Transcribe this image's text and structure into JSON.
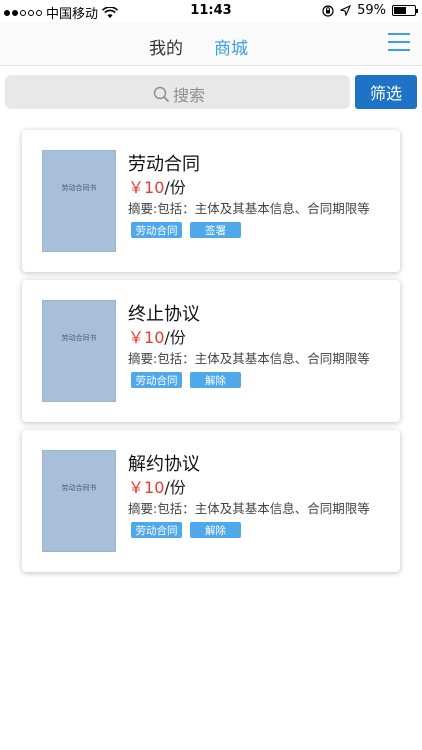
{
  "status_bar": {
    "carrier": "中国移动",
    "time": "11:43",
    "battery": "59%",
    "battery_level": 0.59,
    "signal_bars_filled": 2,
    "signal_bars_total": 5
  },
  "nav": {
    "tabs": [
      {
        "label": "我的",
        "active": false
      },
      {
        "label": "商城",
        "active": true
      }
    ],
    "accent_color": "#3a9ee8",
    "menu_icon": "hamburger-menu-icon"
  },
  "search": {
    "placeholder": "搜索",
    "icon": "search-icon",
    "filter_label": "筛选",
    "filter_color": "#1f73c6"
  },
  "products": [
    {
      "title": "劳动合同",
      "price_symbol": "￥",
      "price_amount": "10",
      "price_unit": "/份",
      "summary": "摘要:包括：主体及其基本信息、合同期限等",
      "tags": [
        "劳动合同",
        "签署"
      ],
      "thumb_title": "劳动合同书"
    },
    {
      "title": "终止协议",
      "price_symbol": "￥",
      "price_amount": "10",
      "price_unit": "/份",
      "summary": "摘要:包括：主体及其基本信息、合同期限等",
      "tags": [
        "劳动合同",
        "解除"
      ],
      "thumb_title": "劳动合同书"
    },
    {
      "title": "解约协议",
      "price_symbol": "￥",
      "price_amount": "10",
      "price_unit": "/份",
      "summary": "摘要:包括：主体及其基本信息、合同期限等",
      "tags": [
        "劳动合同",
        "解除"
      ],
      "thumb_title": "劳动合同书"
    }
  ],
  "colors": {
    "price": "#e83b30",
    "tag": "#4ea8ea"
  }
}
